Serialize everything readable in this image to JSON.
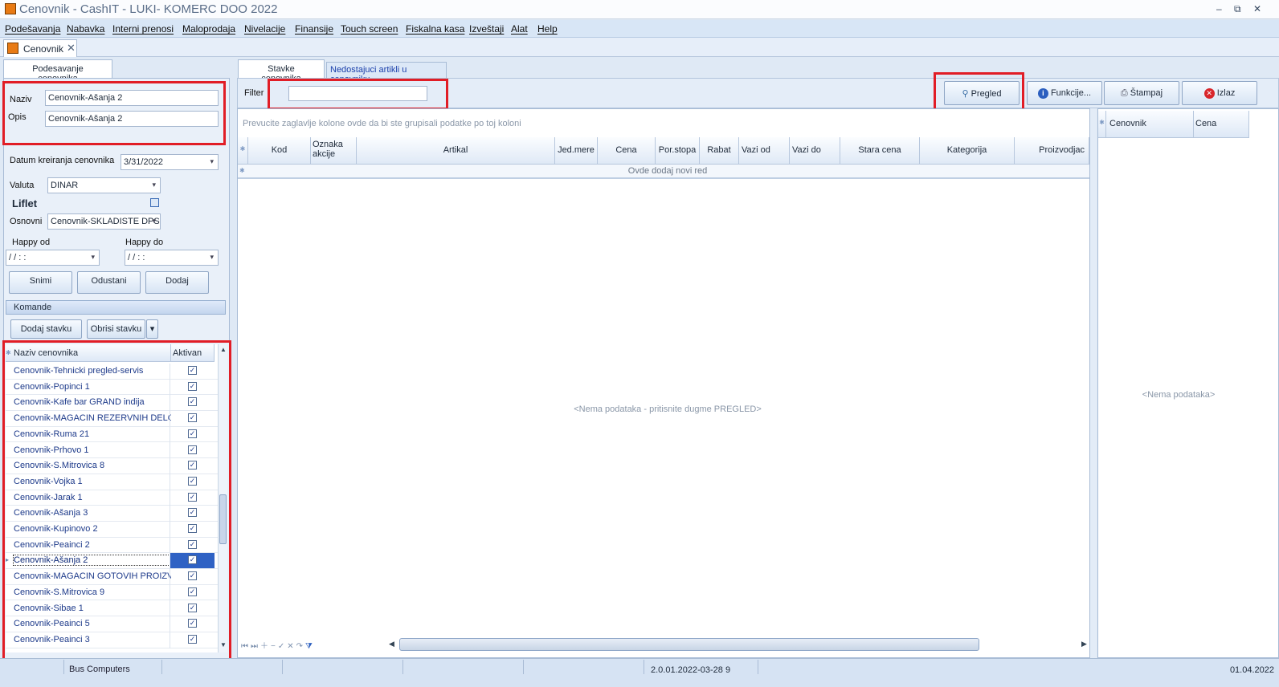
{
  "window": {
    "title": "Cenovnik - CashIT - LUKI- KOMERC DOO 2022",
    "controls": {
      "minimize": "–",
      "restore": "⧉",
      "close": "✕"
    }
  },
  "menu": {
    "items": [
      "Podešavanja",
      "Nabavka",
      "Interni prenosi",
      "Maloprodaja",
      "Nivelacije",
      "Finansije",
      "Touch screen",
      "Fiskalna kasa",
      "Izveštaji",
      "Alat",
      "Help"
    ]
  },
  "doc_tab": {
    "label": "Cenovnik",
    "close": "✕"
  },
  "left_panel": {
    "tab": "Podesavanje cenovnika",
    "naziv_label": "Naziv",
    "naziv_value": "Cenovnik-Ašanja 2",
    "opis_label": "Opis",
    "opis_value": "Cenovnik-Ašanja 2",
    "datum_label": "Datum kreiranja cenovnika",
    "datum_value": "3/31/2022",
    "valuta_label": "Valuta",
    "valuta_value": "DINAR",
    "liflet_label": "Liflet",
    "osnovni_label": "Osnovni",
    "osnovni_value": "Cenovnik-SKLADISTE DPS",
    "happy_od_label": "Happy od",
    "happy_do_label": "Happy do",
    "happy_od_value": "/ /      : :",
    "happy_do_value": "/ /      : :",
    "buttons": {
      "snimi": "Snimi",
      "odustani": "Odustani",
      "dodaj": "Dodaj"
    },
    "komande_label": "Komande",
    "dodaj_stavku": "Dodaj stavku",
    "obrisi_stavku": "Obrisi stavku",
    "list": {
      "col_name": "Naziv cenovnika",
      "col_active": "Aktivan",
      "rows": [
        "Cenovnik-Tehnicki pregled-servis",
        "Cenovnik-Popinci 1",
        "Cenovnik-Kafe bar GRAND indija",
        "Cenovnik-MAGACIN REZERVNIH DELOVA",
        "Cenovnik-Ruma 21",
        "Cenovnik-Prhovo 1",
        "Cenovnik-S.Mitrovica 8",
        "Cenovnik-Vojka 1",
        "Cenovnik-Jarak 1",
        "Cenovnik-Ašanja 3",
        "Cenovnik-Kupinovo 2",
        "Cenovnik-Peainci 2",
        "Cenovnik-Ašanja 2",
        "Cenovnik-MAGACIN GOTOVIH PROIZVODA",
        "Cenovnik-S.Mitrovica 9",
        "Cenovnik-Sibae 1",
        "Cenovnik-Peainci 5",
        "Cenovnik-Peainci 3"
      ],
      "selected_index": 12
    }
  },
  "center": {
    "tab_active": "Stavke cenovnika",
    "tab_inactive": "Nedostajuci artikli u cenovniku",
    "filter_label": "Filter",
    "filter_value": "",
    "pregled": "Pregled",
    "funkcije": "Funkcije...",
    "stampaj": "Štampaj",
    "izlaz": "Izlaz",
    "group_hint": "Prevucite zaglavlje kolone ovde da bi ste grupisali podatke po toj koloni",
    "columns": [
      "Kod",
      "Oznaka akcije",
      "Artikal",
      "Jed.mere",
      "Cena",
      "Por.stopa",
      "Rabat",
      "Vazi od",
      "Vazi do",
      "Stara cena",
      "Kategorija",
      "Proizvodjac"
    ],
    "new_row": "Ovde dodaj novi red",
    "empty": "<Nema podataka - pritisnite dugme PREGLED>"
  },
  "right_panel": {
    "col1": "Cenovnik",
    "col2": "Cena",
    "empty": "<Nema podataka>"
  },
  "status": {
    "company": "Bus Computers",
    "version": "2.0.01.2022-03-28 9",
    "date": "01.04.2022"
  }
}
